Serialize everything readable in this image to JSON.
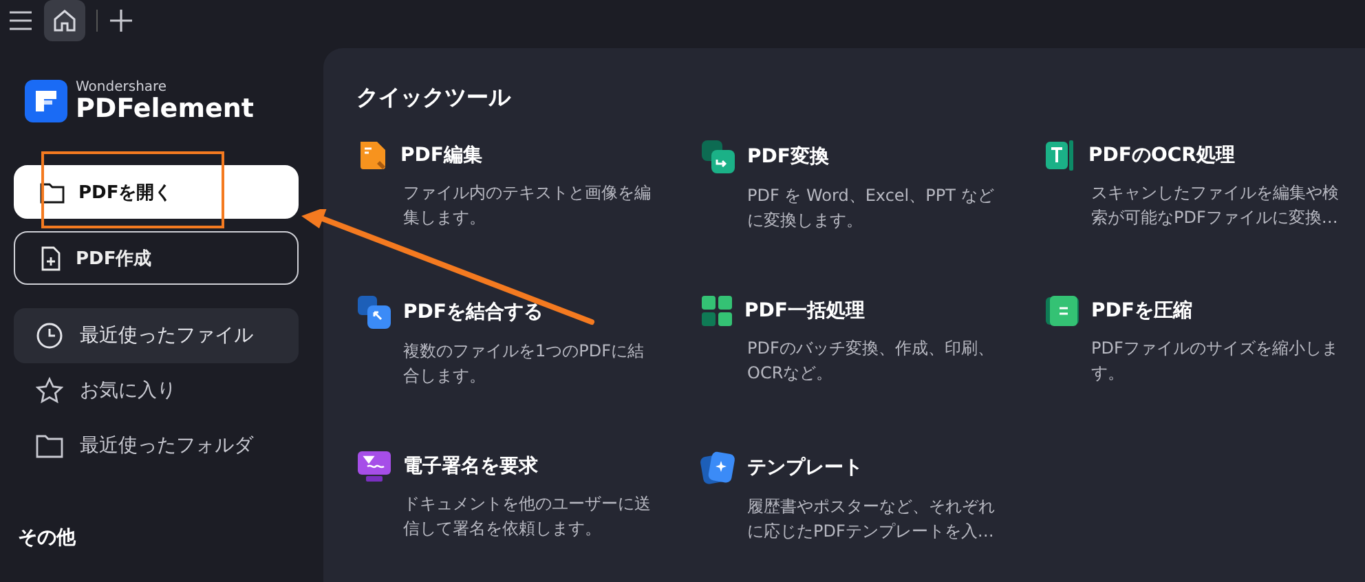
{
  "topbar": {
    "home_tab_selected": true
  },
  "logo": {
    "company": "Wondershare",
    "product": "PDFelement"
  },
  "actions": [
    {
      "label": "PDFを開く",
      "kind": "open",
      "primary": true
    },
    {
      "label": "PDF作成",
      "kind": "create",
      "primary": false
    }
  ],
  "sidebar": {
    "items": [
      {
        "label": "最近使ったファイル",
        "kind": "clock",
        "selected": true
      },
      {
        "label": "お気に入り",
        "kind": "star",
        "selected": false
      },
      {
        "label": "最近使ったフォルダ",
        "kind": "folder",
        "selected": false
      }
    ],
    "section": "その他"
  },
  "quick_tools": {
    "title": "クイックツール",
    "items": [
      {
        "title": "PDF編集",
        "description": "ファイル内のテキストと画像を編集します。",
        "kind": "edit"
      },
      {
        "title": "PDF変換",
        "description": "PDF を Word、Excel、PPT などに変換します。",
        "kind": "convert"
      },
      {
        "title": "PDFのOCR処理",
        "description": "スキャンしたファイルを編集や検索が可能なPDFファイルに変換…",
        "kind": "ocr"
      },
      {
        "title": "PDFを結合する",
        "description": "複数のファイルを1つのPDFに結合します。",
        "kind": "combine"
      },
      {
        "title": "PDF一括処理",
        "description": "PDFのバッチ変換、作成、印刷、OCRなど。",
        "kind": "batch"
      },
      {
        "title": "PDFを圧縮",
        "description": "PDFファイルのサイズを縮小します。",
        "kind": "compress"
      },
      {
        "title": "電子署名を要求",
        "description": "ドキュメントを他のユーザーに送信して署名を依頼します。",
        "kind": "sign"
      },
      {
        "title": "テンプレート",
        "description": "履歴書やポスターなど、それぞれに応じたPDFテンプレートを入…",
        "kind": "template"
      }
    ]
  }
}
